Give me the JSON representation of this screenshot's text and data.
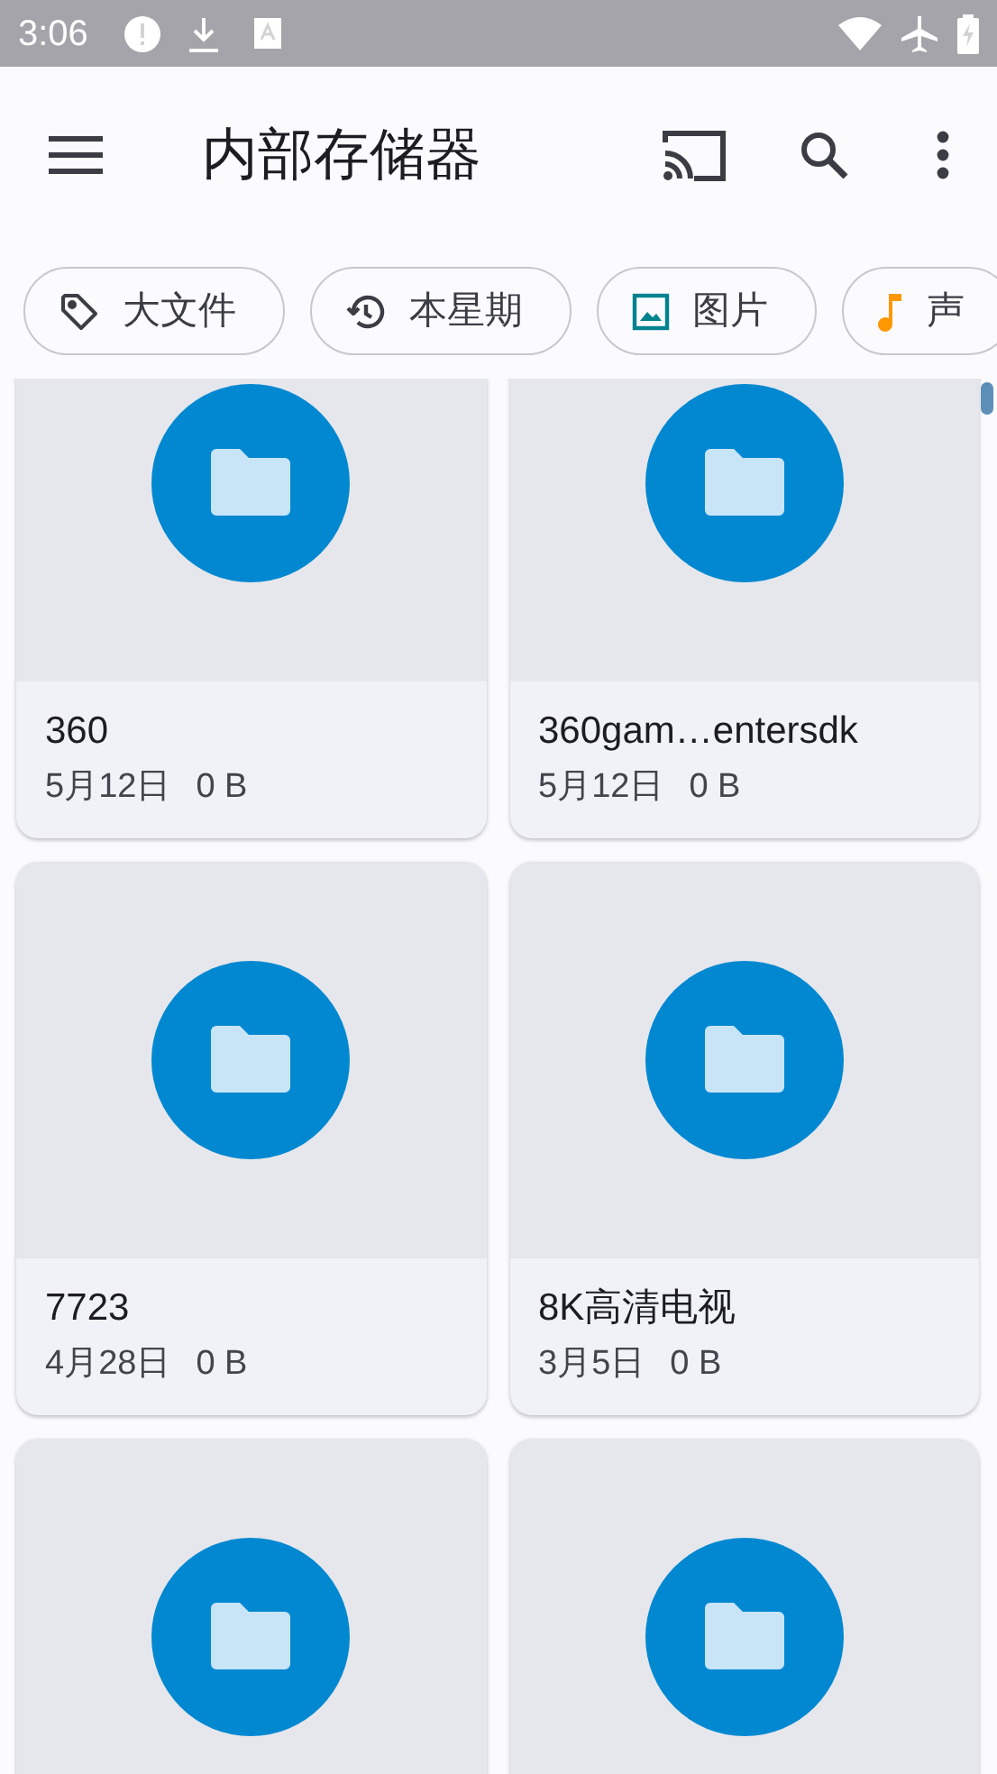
{
  "status_bar": {
    "time": "3:06"
  },
  "app_bar": {
    "title": "内部存储器"
  },
  "chips": [
    {
      "label": "大文件",
      "kind": "tag"
    },
    {
      "label": "本星期",
      "kind": "history"
    },
    {
      "label": "图片",
      "kind": "image"
    },
    {
      "label": "声",
      "kind": "audio"
    }
  ],
  "files": [
    {
      "kind": "folder",
      "name": "360",
      "date": "5月12日",
      "size": "0 B"
    },
    {
      "kind": "folder",
      "name": "360gam…entersdk",
      "date": "5月12日",
      "size": "0 B"
    },
    {
      "kind": "folder",
      "name": "7723",
      "date": "4月28日",
      "size": "0 B"
    },
    {
      "kind": "folder",
      "name": "8K高清电视",
      "date": "3月5日",
      "size": "0 B"
    },
    {
      "kind": "folder"
    },
    {
      "kind": "folder"
    }
  ]
}
